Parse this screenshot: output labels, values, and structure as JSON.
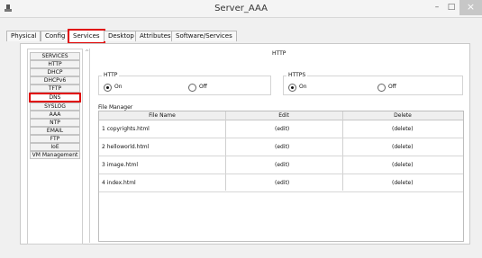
{
  "window": {
    "title": "Server_AAA",
    "minimize": "–",
    "maximize": "□",
    "close": "×"
  },
  "tabs": [
    {
      "label": "Physical"
    },
    {
      "label": "Config"
    },
    {
      "label": "Services"
    },
    {
      "label": "Desktop"
    },
    {
      "label": "Attributes"
    },
    {
      "label": "Software/Services"
    }
  ],
  "services": [
    "SERVICES",
    "HTTP",
    "DHCP",
    "DHCPv6",
    "TFTP",
    "DNS",
    "SYSLOG",
    "AAA",
    "NTP",
    "EMAIL",
    "FTP",
    "IoE",
    "VM Management"
  ],
  "selected_service": "DNS",
  "http_section": {
    "header": "HTTP",
    "http": {
      "label": "HTTP",
      "on": "On",
      "off": "Off",
      "selected": "On"
    },
    "https": {
      "label": "HTTPS",
      "on": "On",
      "off": "Off",
      "selected": "On"
    }
  },
  "file_manager": {
    "label": "File Manager",
    "columns": [
      "File Name",
      "Edit",
      "Delete"
    ],
    "rows": [
      {
        "name": "1  copyrights.html",
        "edit": "(edit)",
        "delete": "(delete)"
      },
      {
        "name": "2  helloworld.html",
        "edit": "(edit)",
        "delete": "(delete)"
      },
      {
        "name": "3  image.html",
        "edit": "(edit)",
        "delete": "(delete)"
      },
      {
        "name": "4  index.html",
        "edit": "(edit)",
        "delete": "(delete)"
      }
    ]
  }
}
